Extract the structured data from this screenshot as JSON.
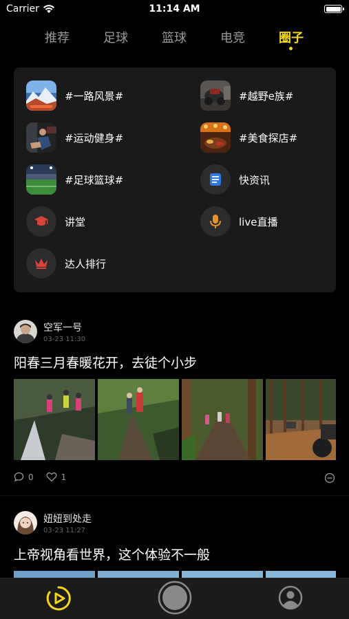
{
  "status": {
    "carrier": "Carrier",
    "time": "11:14 AM",
    "battery_level": 1.0
  },
  "tabs": [
    {
      "label": "推荐",
      "active": false
    },
    {
      "label": "足球",
      "active": false
    },
    {
      "label": "篮球",
      "active": false
    },
    {
      "label": "电竞",
      "active": false
    },
    {
      "label": "圈子",
      "active": true
    }
  ],
  "circles": [
    {
      "label": "#一路风景#",
      "icon": "scenery-photo"
    },
    {
      "label": "#越野e族#",
      "icon": "offroad-photo"
    },
    {
      "label": "#运动健身#",
      "icon": "fitness-photo"
    },
    {
      "label": "#美食探店#",
      "icon": "food-photo"
    },
    {
      "label": "#足球篮球#",
      "icon": "stadium-photo"
    },
    {
      "label": "快资讯",
      "icon": "news-icon"
    },
    {
      "label": "讲堂",
      "icon": "graduation-cap-icon"
    },
    {
      "label": "live直播",
      "icon": "microphone-icon"
    },
    {
      "label": "达人排行",
      "icon": "crown-icon"
    }
  ],
  "posts": [
    {
      "user": "空军一号",
      "time": "03-23 11:30",
      "title": "阳春三月春暖花开，去徒个小步",
      "comments": "0",
      "likes": "1"
    },
    {
      "user": "妞妞到处走",
      "time": "03-23 11:27",
      "title": "上帝视角看世界，这个体验不一般"
    }
  ],
  "colors": {
    "accent": "#f4d61c",
    "panel": "#1a1a1a",
    "background": "#000000"
  },
  "bottom_nav": [
    {
      "icon": "play-circle-icon",
      "active": true
    },
    {
      "icon": "camera-shutter-icon",
      "active": false
    },
    {
      "icon": "profile-icon",
      "active": false
    }
  ]
}
